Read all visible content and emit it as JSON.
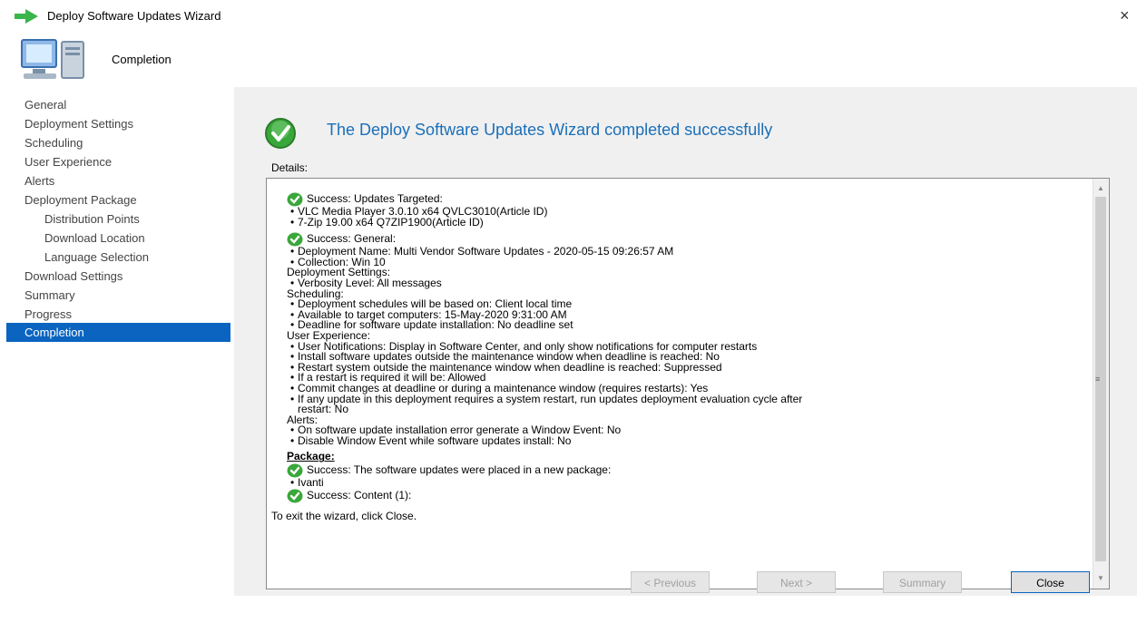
{
  "window": {
    "title": "Deploy Software Updates Wizard"
  },
  "header": {
    "page_title": "Completion"
  },
  "nav": [
    {
      "label": "General"
    },
    {
      "label": "Deployment Settings"
    },
    {
      "label": "Scheduling"
    },
    {
      "label": "User Experience"
    },
    {
      "label": "Alerts"
    },
    {
      "label": "Deployment Package"
    },
    {
      "label": "Distribution Points"
    },
    {
      "label": "Download Location"
    },
    {
      "label": "Language Selection"
    },
    {
      "label": "Download Settings"
    },
    {
      "label": "Summary"
    },
    {
      "label": "Progress"
    },
    {
      "label": "Completion"
    }
  ],
  "main": {
    "title": "The Deploy Software Updates Wizard completed successfully",
    "details_label": "Details:",
    "exit_text": "To exit the wizard, click Close."
  },
  "details": {
    "updates_head": "Success: Updates Targeted:",
    "updates": [
      "VLC Media Player 3.0.10 x64 QVLC3010(Article ID)",
      "7-Zip 19.00 x64 Q7ZIP1900(Article ID)"
    ],
    "general_head": "Success: General:",
    "general": [
      "Deployment Name: Multi Vendor Software Updates - 2020-05-15 09:26:57 AM",
      "Collection: Win 10"
    ],
    "deploy_head": "Deployment Settings:",
    "deploy": [
      "Verbosity Level: All messages"
    ],
    "sched_head": "Scheduling:",
    "sched": [
      "Deployment schedules will be based on: Client local time",
      "Available to target computers: 15-May-2020 9:31:00 AM",
      "Deadline for software update installation: No deadline set"
    ],
    "ux_head": "User Experience:",
    "ux": [
      "User Notifications: Display in Software Center, and only show notifications for computer restarts",
      "Install software updates outside the maintenance window when deadline is reached: No",
      "Restart system outside the maintenance window when deadline is reached: Suppressed",
      "If a restart is required it will be: Allowed",
      "Commit changes at deadline or during a maintenance window (requires restarts): Yes",
      "If any update in this deployment requires a system restart, run updates deployment evaluation cycle after",
      "restart: No"
    ],
    "alerts_head": "Alerts:",
    "alerts": [
      "On software update installation error generate a Window Event: No",
      "Disable Window Event while software updates install: No"
    ],
    "package_head": "Package:",
    "package_success": "Success: The software updates were placed in a new package:",
    "package_items": [
      "Ivanti"
    ],
    "content_head": "Success: Content (1):"
  },
  "buttons": {
    "previous": "< Previous",
    "next": "Next >",
    "summary": "Summary",
    "close": "Close"
  },
  "colors": {
    "accent": "#0a64c0",
    "title_blue": "#1a6fb8",
    "success_green": "#3aa73a"
  }
}
